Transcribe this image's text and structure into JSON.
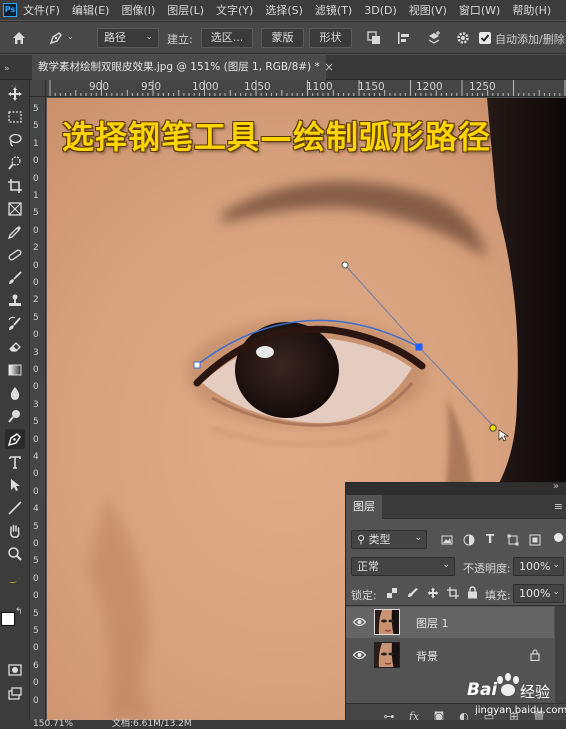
{
  "app": {
    "logo_text": "Ps"
  },
  "menu": [
    "文件(F)",
    "编辑(E)",
    "图像(I)",
    "图层(L)",
    "文字(Y)",
    "选择(S)",
    "滤镜(T)",
    "3D(D)",
    "视图(V)",
    "窗口(W)",
    "帮助(H)"
  ],
  "options_bar": {
    "mode_value": "路径",
    "make_label": "建立:",
    "selection_button": "选区...",
    "mask_button": "蒙版",
    "shape_button": "形状",
    "auto_add_delete_label": "自动添加/删除",
    "auto_add_delete_checked": true
  },
  "document": {
    "tab_title": "教学素材绘制双眼皮效果.jpg @ 151% (图层 1, RGB/8#) *",
    "close_glyph": "×"
  },
  "ruler": {
    "top_labels": [
      "900",
      "950",
      "1000",
      "1050",
      "1100",
      "1150",
      "1200",
      "1250"
    ],
    "left_labels": [
      "5",
      "5",
      "1",
      "0",
      "0",
      "1",
      "5",
      "0",
      "2",
      "0",
      "0",
      "2",
      "5",
      "0",
      "3",
      "0",
      "0",
      "3",
      "5",
      "0",
      "4",
      "0",
      "0",
      "4",
      "5",
      "0",
      "5",
      "0",
      "0",
      "5",
      "5",
      "0",
      "6",
      "0",
      "0"
    ]
  },
  "canvas": {
    "overlay_title": "选择钢笔工具—绘制弧形路径"
  },
  "status": {
    "zoom": "150.71%",
    "doc_info": "文档:6.61M/13.2M"
  },
  "layers_panel": {
    "tab_label": "图层",
    "filter_kind": "类型",
    "blend_mode": "正常",
    "opacity_label": "不透明度:",
    "opacity_value": "100%",
    "lock_label": "锁定:",
    "fill_label": "填充:",
    "fill_value": "100%",
    "layers": [
      {
        "name": "图层 1",
        "selected": true,
        "locked": false
      },
      {
        "name": "背景",
        "selected": false,
        "locked": true
      }
    ]
  },
  "watermark": {
    "brand": "Bai",
    "brand_suffix": "经验",
    "url": "jingyan.baidu.com"
  },
  "colors": {
    "accent_path": "#3a7bd5",
    "title_yellow": "#ffd400",
    "selected_layer": "#646464",
    "app_bg": "#535353"
  }
}
